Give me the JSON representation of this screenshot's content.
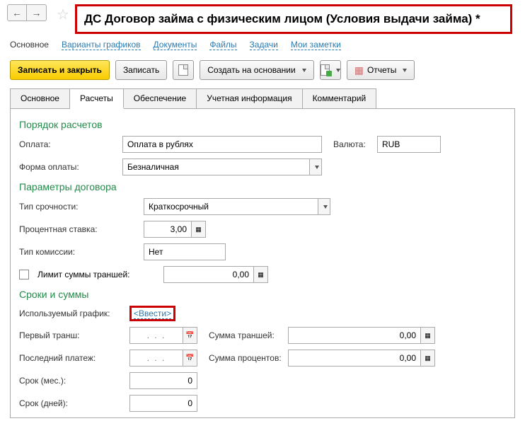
{
  "title": "ДС Договор займа с физическим лицом (Условия выдачи займа) *",
  "links": [
    "Основное",
    "Варианты графиков",
    "Документы",
    "Файлы",
    "Задачи",
    "Мои заметки"
  ],
  "toolbar": {
    "save_close": "Записать и закрыть",
    "save": "Записать",
    "create_based": "Создать на основании",
    "reports": "Отчеты"
  },
  "tabs": [
    "Основное",
    "Расчеты",
    "Обеспечение",
    "Учетная информация",
    "Комментарий"
  ],
  "s1": {
    "title": "Порядок расчетов",
    "payment_lbl": "Оплата:",
    "payment_val": "Оплата в рублях",
    "currency_lbl": "Валюта:",
    "currency_val": "RUB",
    "form_lbl": "Форма оплаты:",
    "form_val": "Безналичная"
  },
  "s2": {
    "title": "Параметры договора",
    "urg_lbl": "Тип срочности:",
    "urg_val": "Краткосрочный",
    "rate_lbl": "Процентная ставка:",
    "rate_val": "3,00",
    "comm_lbl": "Тип комиссии:",
    "comm_val": "Нет",
    "limit_lbl": "Лимит суммы траншей:",
    "limit_val": "0,00"
  },
  "s3": {
    "title": "Сроки и суммы",
    "graph_lbl": "Используемый график:",
    "graph_val": "<Ввести>",
    "first_lbl": "Первый транш:",
    "sum_t_lbl": "Сумма траншей:",
    "sum_t_val": "0,00",
    "last_lbl": "Последний платеж:",
    "sum_p_lbl": "Сумма процентов:",
    "sum_p_val": "0,00",
    "term_m_lbl": "Срок (мес.):",
    "term_m_val": "0",
    "term_d_lbl": "Срок (дней):",
    "term_d_val": "0",
    "date_ph": ". . ."
  }
}
